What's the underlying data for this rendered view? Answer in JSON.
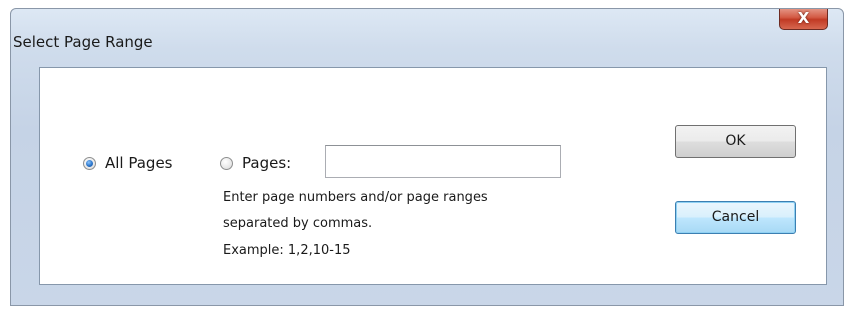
{
  "dialog": {
    "title": "Select Page Range",
    "close_label": "X"
  },
  "range": {
    "all_pages_label": "All Pages",
    "all_pages_selected": true,
    "pages_label": "Pages:",
    "pages_selected": false,
    "pages_value": "",
    "help_line_1": "Enter page numbers and/or page ranges",
    "help_line_2": "separated by commas.",
    "example": "Example: 1,2,10-15"
  },
  "buttons": {
    "ok_label": "OK",
    "cancel_label": "Cancel"
  }
}
